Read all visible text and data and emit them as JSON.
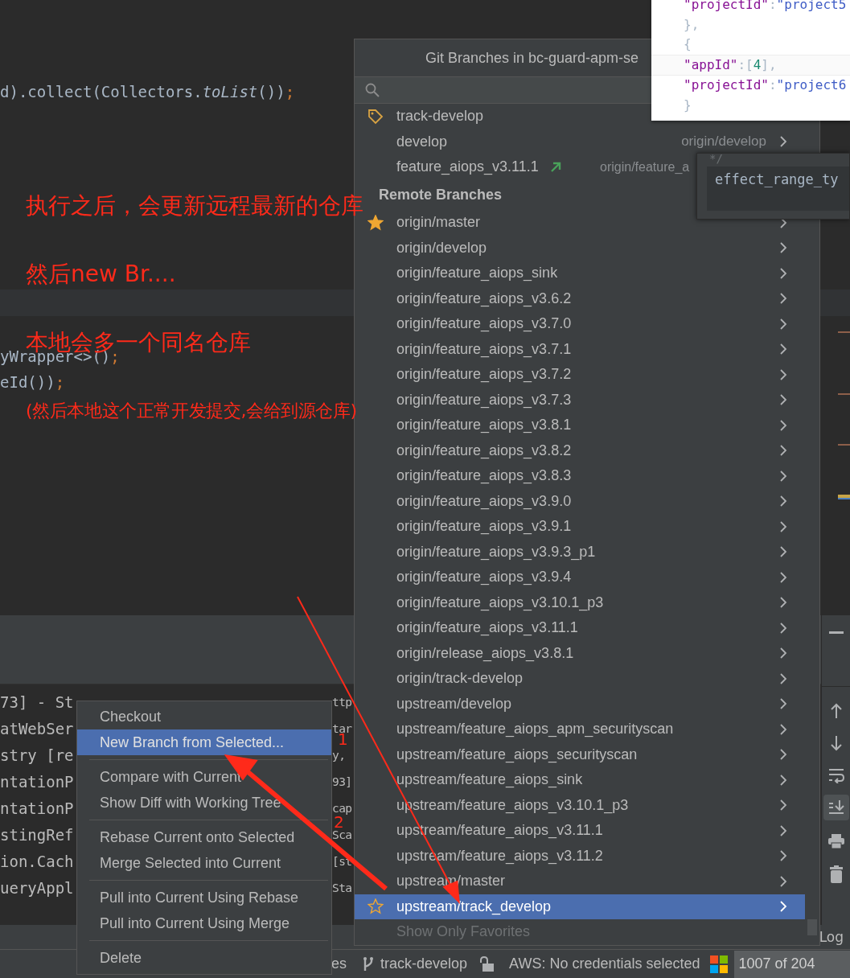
{
  "editor": {
    "code_top": [
      {
        "text": "d).collect(Collectors.",
        "kind": "plain"
      },
      {
        "text": "toList",
        "kind": "italic"
      },
      {
        "text": "())",
        "kind": "plain"
      },
      {
        "text": ";",
        "kind": "punct"
      }
    ],
    "code_bottom": [
      [
        {
          "text": "yWrapper<>()",
          "kind": "plain"
        },
        {
          "text": ";",
          "kind": "punct"
        }
      ],
      [
        {
          "text": "eId())",
          "kind": "plain"
        },
        {
          "text": ";",
          "kind": "punct"
        }
      ]
    ]
  },
  "json_preview": {
    "lines": [
      {
        "parts": [
          {
            "text": "\"projectId\"",
            "kind": "key"
          },
          {
            "text": ":",
            "kind": "plain"
          },
          {
            "text": "\"project5",
            "kind": "string"
          }
        ]
      },
      {
        "parts": [
          {
            "text": "},",
            "kind": "plain"
          }
        ]
      },
      {
        "parts": [
          {
            "text": "{",
            "kind": "plain"
          }
        ]
      },
      {
        "parts": [
          {
            "text": "\"appId\"",
            "kind": "key"
          },
          {
            "text": ":[",
            "kind": "plain"
          },
          {
            "text": "4",
            "kind": "number"
          },
          {
            "text": "],",
            "kind": "plain"
          }
        ]
      },
      {
        "parts": [
          {
            "text": "\"projectId\"",
            "kind": "key"
          },
          {
            "text": ":",
            "kind": "plain"
          },
          {
            "text": "\"project6",
            "kind": "string"
          }
        ]
      },
      {
        "parts": [
          {
            "text": "}",
            "kind": "plain"
          }
        ]
      }
    ]
  },
  "doc_tooltip": {
    "comment": "*/",
    "text": "effect_range_ty"
  },
  "git_branches": {
    "title": "Git Branches in bc-guard-apm-se",
    "local": [
      {
        "name": "track-develop",
        "kind": "tag",
        "chevron": false,
        "favorite": false,
        "selected": false
      },
      {
        "name": "develop",
        "kind": "branch",
        "tracking": "origin/develop",
        "chevron": true,
        "favorite": false,
        "selected": false
      },
      {
        "name": "feature_aiops_v3.11.1",
        "kind": "branch",
        "outgoing": true,
        "tracking": "origin/feature_a",
        "chevron": false,
        "favorite": false,
        "selected": false
      }
    ],
    "remote_header": "Remote Branches",
    "remote": [
      {
        "name": "origin/master",
        "favorite": true,
        "selected": false
      },
      {
        "name": "origin/develop",
        "favorite": false,
        "selected": false
      },
      {
        "name": "origin/feature_aiops_sink",
        "favorite": false,
        "selected": false
      },
      {
        "name": "origin/feature_aiops_v3.6.2",
        "favorite": false,
        "selected": false
      },
      {
        "name": "origin/feature_aiops_v3.7.0",
        "favorite": false,
        "selected": false
      },
      {
        "name": "origin/feature_aiops_v3.7.1",
        "favorite": false,
        "selected": false
      },
      {
        "name": "origin/feature_aiops_v3.7.2",
        "favorite": false,
        "selected": false
      },
      {
        "name": "origin/feature_aiops_v3.7.3",
        "favorite": false,
        "selected": false
      },
      {
        "name": "origin/feature_aiops_v3.8.1",
        "favorite": false,
        "selected": false
      },
      {
        "name": "origin/feature_aiops_v3.8.2",
        "favorite": false,
        "selected": false
      },
      {
        "name": "origin/feature_aiops_v3.8.3",
        "favorite": false,
        "selected": false
      },
      {
        "name": "origin/feature_aiops_v3.9.0",
        "favorite": false,
        "selected": false
      },
      {
        "name": "origin/feature_aiops_v3.9.1",
        "favorite": false,
        "selected": false
      },
      {
        "name": "origin/feature_aiops_v3.9.3_p1",
        "favorite": false,
        "selected": false
      },
      {
        "name": "origin/feature_aiops_v3.9.4",
        "favorite": false,
        "selected": false
      },
      {
        "name": "origin/feature_aiops_v3.10.1_p3",
        "favorite": false,
        "selected": false
      },
      {
        "name": "origin/feature_aiops_v3.11.1",
        "favorite": false,
        "selected": false
      },
      {
        "name": "origin/release_aiops_v3.8.1",
        "favorite": false,
        "selected": false
      },
      {
        "name": "origin/track-develop",
        "favorite": false,
        "selected": false
      },
      {
        "name": "upstream/develop",
        "favorite": false,
        "selected": false
      },
      {
        "name": "upstream/feature_aiops_apm_securityscan",
        "favorite": false,
        "selected": false
      },
      {
        "name": "upstream/feature_aiops_securityscan",
        "favorite": false,
        "selected": false
      },
      {
        "name": "upstream/feature_aiops_sink",
        "favorite": false,
        "selected": false
      },
      {
        "name": "upstream/feature_aiops_v3.10.1_p3",
        "favorite": false,
        "selected": false
      },
      {
        "name": "upstream/feature_aiops_v3.11.1",
        "favorite": false,
        "selected": false
      },
      {
        "name": "upstream/feature_aiops_v3.11.2",
        "favorite": false,
        "selected": false
      },
      {
        "name": "upstream/master",
        "favorite": false,
        "selected": false
      },
      {
        "name": "upstream/track_develop",
        "favorite": true,
        "selected": true
      }
    ],
    "footer": {
      "label": "Show Only Favorites",
      "disabled": true
    }
  },
  "console": {
    "rows": [
      {
        "left": "73] - St",
        "right": "ttp"
      },
      {
        "left": "atWebSer",
        "right": "tar"
      },
      {
        "left": "stry [re",
        "right": "y,"
      },
      {
        "left": "ntationP",
        "right": "93]"
      },
      {
        "left": "ntationP",
        "right": "cap"
      },
      {
        "left": "stingRef",
        "right": "Sca"
      },
      {
        "left": "ion.Cach",
        "right": "[st"
      },
      {
        "left": "ueryAppl",
        "right": "Sta"
      }
    ]
  },
  "context_menu": [
    {
      "kind": "item",
      "label": "Checkout",
      "selected": false
    },
    {
      "kind": "item",
      "label": "New Branch from Selected...",
      "selected": true
    },
    {
      "kind": "separator"
    },
    {
      "kind": "item",
      "label": "Compare with Current",
      "selected": false
    },
    {
      "kind": "item",
      "label": "Show Diff with Working Tree",
      "selected": false
    },
    {
      "kind": "separator"
    },
    {
      "kind": "item",
      "label": "Rebase Current onto Selected",
      "selected": false
    },
    {
      "kind": "item",
      "label": "Merge Selected into Current",
      "selected": false
    },
    {
      "kind": "separator"
    },
    {
      "kind": "item",
      "label": "Pull into Current Using Rebase",
      "selected": false
    },
    {
      "kind": "item",
      "label": "Pull into Current Using Merge",
      "selected": false
    },
    {
      "kind": "separator"
    },
    {
      "kind": "item",
      "label": "Delete",
      "selected": false
    }
  ],
  "tool_tabs": {
    "right_label": "Log"
  },
  "status_bar": {
    "left_fragment": "es",
    "branch": "track-develop",
    "locked": false,
    "aws": "AWS: No credentials selected",
    "memory": "1007 of 204"
  },
  "annotations": {
    "notes": [
      "执行之后，会更新远程最新的仓库",
      "然后new Br....",
      "本地会多一个同名仓库",
      "(然后本地这个正常开发提交,会给到源仓库)"
    ],
    "arrow_labels": [
      "1",
      "2"
    ]
  }
}
